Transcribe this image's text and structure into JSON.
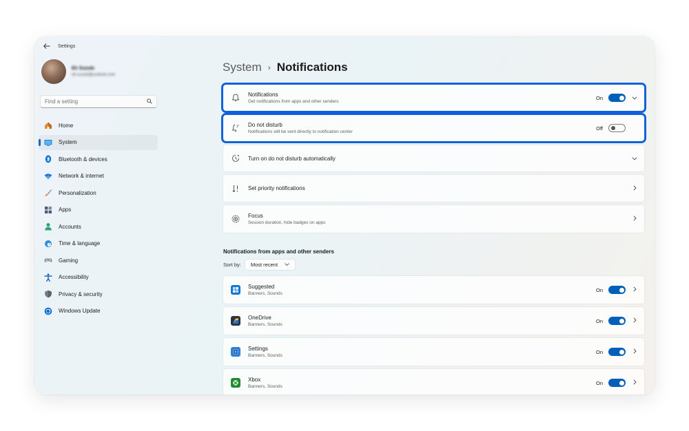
{
  "window": {
    "title": "Settings"
  },
  "profile": {
    "name": "Eli Suzuki",
    "email": "eli.suzuki@outlook.com"
  },
  "search": {
    "placeholder": "Find a setting"
  },
  "sidebar": {
    "items": [
      {
        "label": "Home",
        "icon": "home-icon",
        "color": "#d97a2b"
      },
      {
        "label": "System",
        "icon": "system-icon",
        "color": "#0078d4"
      },
      {
        "label": "Bluetooth & devices",
        "icon": "bluetooth-icon",
        "color": "#0078d4"
      },
      {
        "label": "Network & internet",
        "icon": "network-icon",
        "color": "#1a73e8"
      },
      {
        "label": "Personalization",
        "icon": "brush-icon",
        "color": "#d18a35"
      },
      {
        "label": "Apps",
        "icon": "apps-icon",
        "color": "#4a5a72"
      },
      {
        "label": "Accounts",
        "icon": "accounts-icon",
        "color": "#2aa872"
      },
      {
        "label": "Time & language",
        "icon": "globe-icon",
        "color": "#1f8ad6"
      },
      {
        "label": "Gaming",
        "icon": "gaming-icon",
        "color": "#7d8792"
      },
      {
        "label": "Accessibility",
        "icon": "accessibility-icon",
        "color": "#1764c0"
      },
      {
        "label": "Privacy & security",
        "icon": "shield-icon",
        "color": "#6f7782"
      },
      {
        "label": "Windows Update",
        "icon": "update-icon",
        "color": "#0a6ed1"
      }
    ]
  },
  "breadcrumb": {
    "parent": "System",
    "separator": "›",
    "current": "Notifications"
  },
  "cards": {
    "notifications": {
      "title": "Notifications",
      "subtitle": "Get notifications from apps and other senders",
      "state": "On",
      "toggle_on": true,
      "icon": "bell-icon"
    },
    "dnd": {
      "title": "Do not disturb",
      "subtitle": "Notifications will be sent directly to notification center",
      "state": "Off",
      "toggle_on": false,
      "icon": "bell-off-icon"
    },
    "auto_dnd": {
      "title": "Turn on do not disturb automatically",
      "icon": "clock-icon"
    },
    "priority": {
      "title": "Set priority notifications",
      "icon": "priority-icon"
    },
    "focus": {
      "title": "Focus",
      "subtitle": "Session duration, hide badges on apps",
      "icon": "focus-icon"
    }
  },
  "apps_section": {
    "heading": "Notifications from apps and other senders",
    "sort_label": "Sort by:",
    "sort_value": "Most recent",
    "apps": [
      {
        "name": "Suggested",
        "sub": "Banners, Sounds",
        "state": "On",
        "icon": "suggested-icon"
      },
      {
        "name": "OneDrive",
        "sub": "Banners, Sounds",
        "state": "On",
        "icon": "onedrive-icon"
      },
      {
        "name": "Settings",
        "sub": "Banners, Sounds",
        "state": "On",
        "icon": "settings-icon"
      },
      {
        "name": "Xbox",
        "sub": "Banners, Sounds",
        "state": "On",
        "icon": "xbox-icon"
      }
    ]
  },
  "colors": {
    "accent": "#005fb8",
    "highlight": "#0f62dc"
  }
}
